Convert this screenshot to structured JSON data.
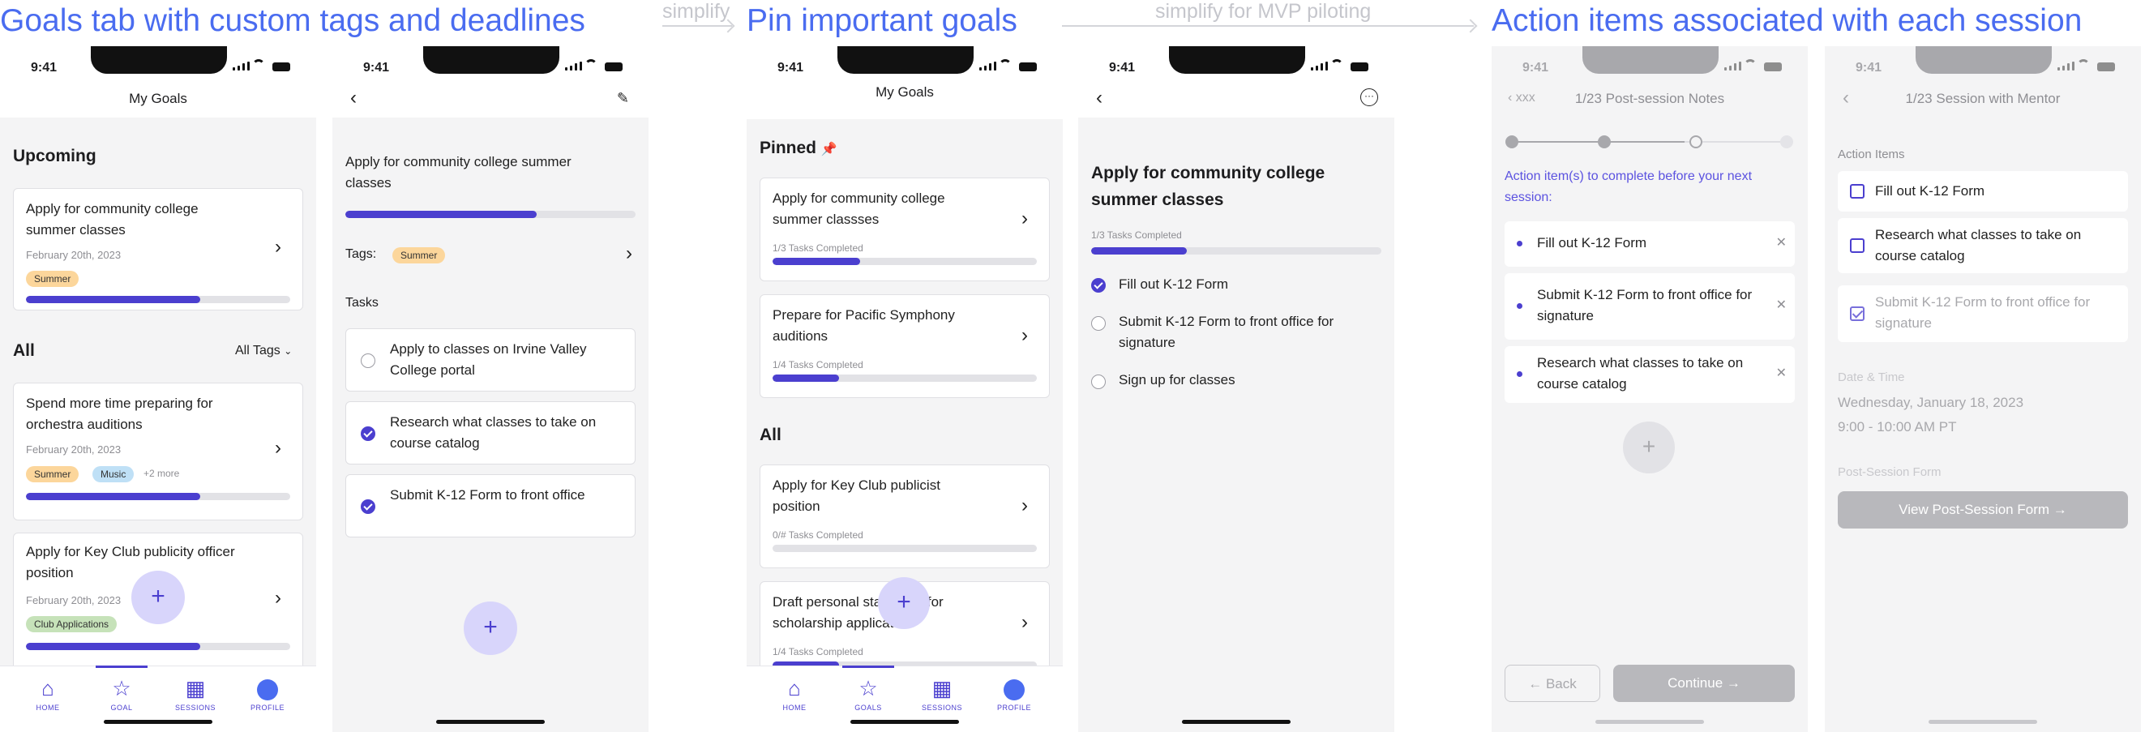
{
  "headings": {
    "h1": "Goals tab with custom tags and deadlines",
    "a1": "simplify",
    "h2": "Pin important goals",
    "a2": "simplify for MVP piloting",
    "h3": "Action items associated with each session"
  },
  "status_time": "9:41",
  "colors": {
    "accent": "#4b3fcf",
    "heading": "#4a6cf0",
    "summer": "#fcd69b",
    "music": "#bfe0f6",
    "club": "#c6e2b9"
  },
  "p1": {
    "title": "My Goals",
    "upcoming": "Upcoming",
    "card1": {
      "title": "Apply for community college summer classes",
      "date": "February 20th, 2023",
      "tag": "Summer",
      "progress": 0.66
    },
    "all": "All",
    "all_tags": "All Tags",
    "card2": {
      "title": "Spend more time preparing for orchestra auditions",
      "date": "February 20th, 2023",
      "tag1": "Summer",
      "tag2": "Music",
      "more": "+2 more",
      "progress": 0.66
    },
    "card3": {
      "title": "Apply for Key Club publicity officer position",
      "date": "February 20th, 2023",
      "tag": "Club Applications",
      "progress": 0.66
    },
    "tabs": [
      "HOME",
      "GOAL",
      "SESSIONS",
      "PROFILE"
    ]
  },
  "p2": {
    "title": "Apply for community college summer classes",
    "progress": 0.66,
    "tags_label": "Tags:",
    "tag": "Summer",
    "tasks_label": "Tasks",
    "tasks": [
      {
        "text": "Apply to classes on Irvine Valley College portal",
        "done": false
      },
      {
        "text": "Research what classes to take on course catalog",
        "done": true
      },
      {
        "text": "Submit K-12 Form to front office",
        "done": true
      }
    ]
  },
  "p3": {
    "title": "My Goals",
    "pinned": "Pinned",
    "pin1": {
      "title": "Apply for community college summer classses",
      "sub": "1/3 Tasks Completed",
      "progress": 0.33
    },
    "pin2": {
      "title": "Prepare for Pacific Symphony auditions",
      "sub": "1/4 Tasks Completed",
      "progress": 0.25
    },
    "all": "All",
    "all1": {
      "title": "Apply for Key Club publicist position",
      "sub": "0/# Tasks Completed",
      "progress": 0
    },
    "all2": {
      "title": "Draft personal statement for scholarship application",
      "sub": "1/4 Tasks Completed",
      "progress": 0.25
    },
    "tabs": [
      "HOME",
      "GOALS",
      "SESSIONS",
      "PROFILE"
    ]
  },
  "p4": {
    "title": "Apply for community college summer classes",
    "sub": "1/3 Tasks Completed",
    "progress": 0.33,
    "tasks": [
      {
        "text": "Fill out K-12 Form",
        "done": true
      },
      {
        "text": "Submit K-12 Form to front office for signature",
        "done": false
      },
      {
        "text": "Sign up for classes",
        "done": false
      }
    ]
  },
  "p5": {
    "back_label": "xxx",
    "title": "1/23 Post-session Notes",
    "prompt": "Action item(s) to complete before your next session:",
    "items": [
      "Fill out K-12 Form",
      "Submit K-12 Form to front office for signature",
      "Research what classes to take on course catalog"
    ],
    "back_btn": "Back",
    "continue_btn": "Continue"
  },
  "p6": {
    "title": "1/23 Session with Mentor",
    "action_label": "Action Items",
    "items": [
      {
        "text": "Fill out K-12 Form",
        "done": false
      },
      {
        "text": "Research what classes to take on course catalog",
        "done": false
      },
      {
        "text": "Submit K-12 Form to front office for signature",
        "done": true
      }
    ],
    "dt_label": "Date & Time",
    "date": "Wednesday, January 18, 2023",
    "time": "9:00 - 10:00 AM PT",
    "form_label": "Post-Session Form",
    "form_btn": "View Post-Session Form"
  }
}
